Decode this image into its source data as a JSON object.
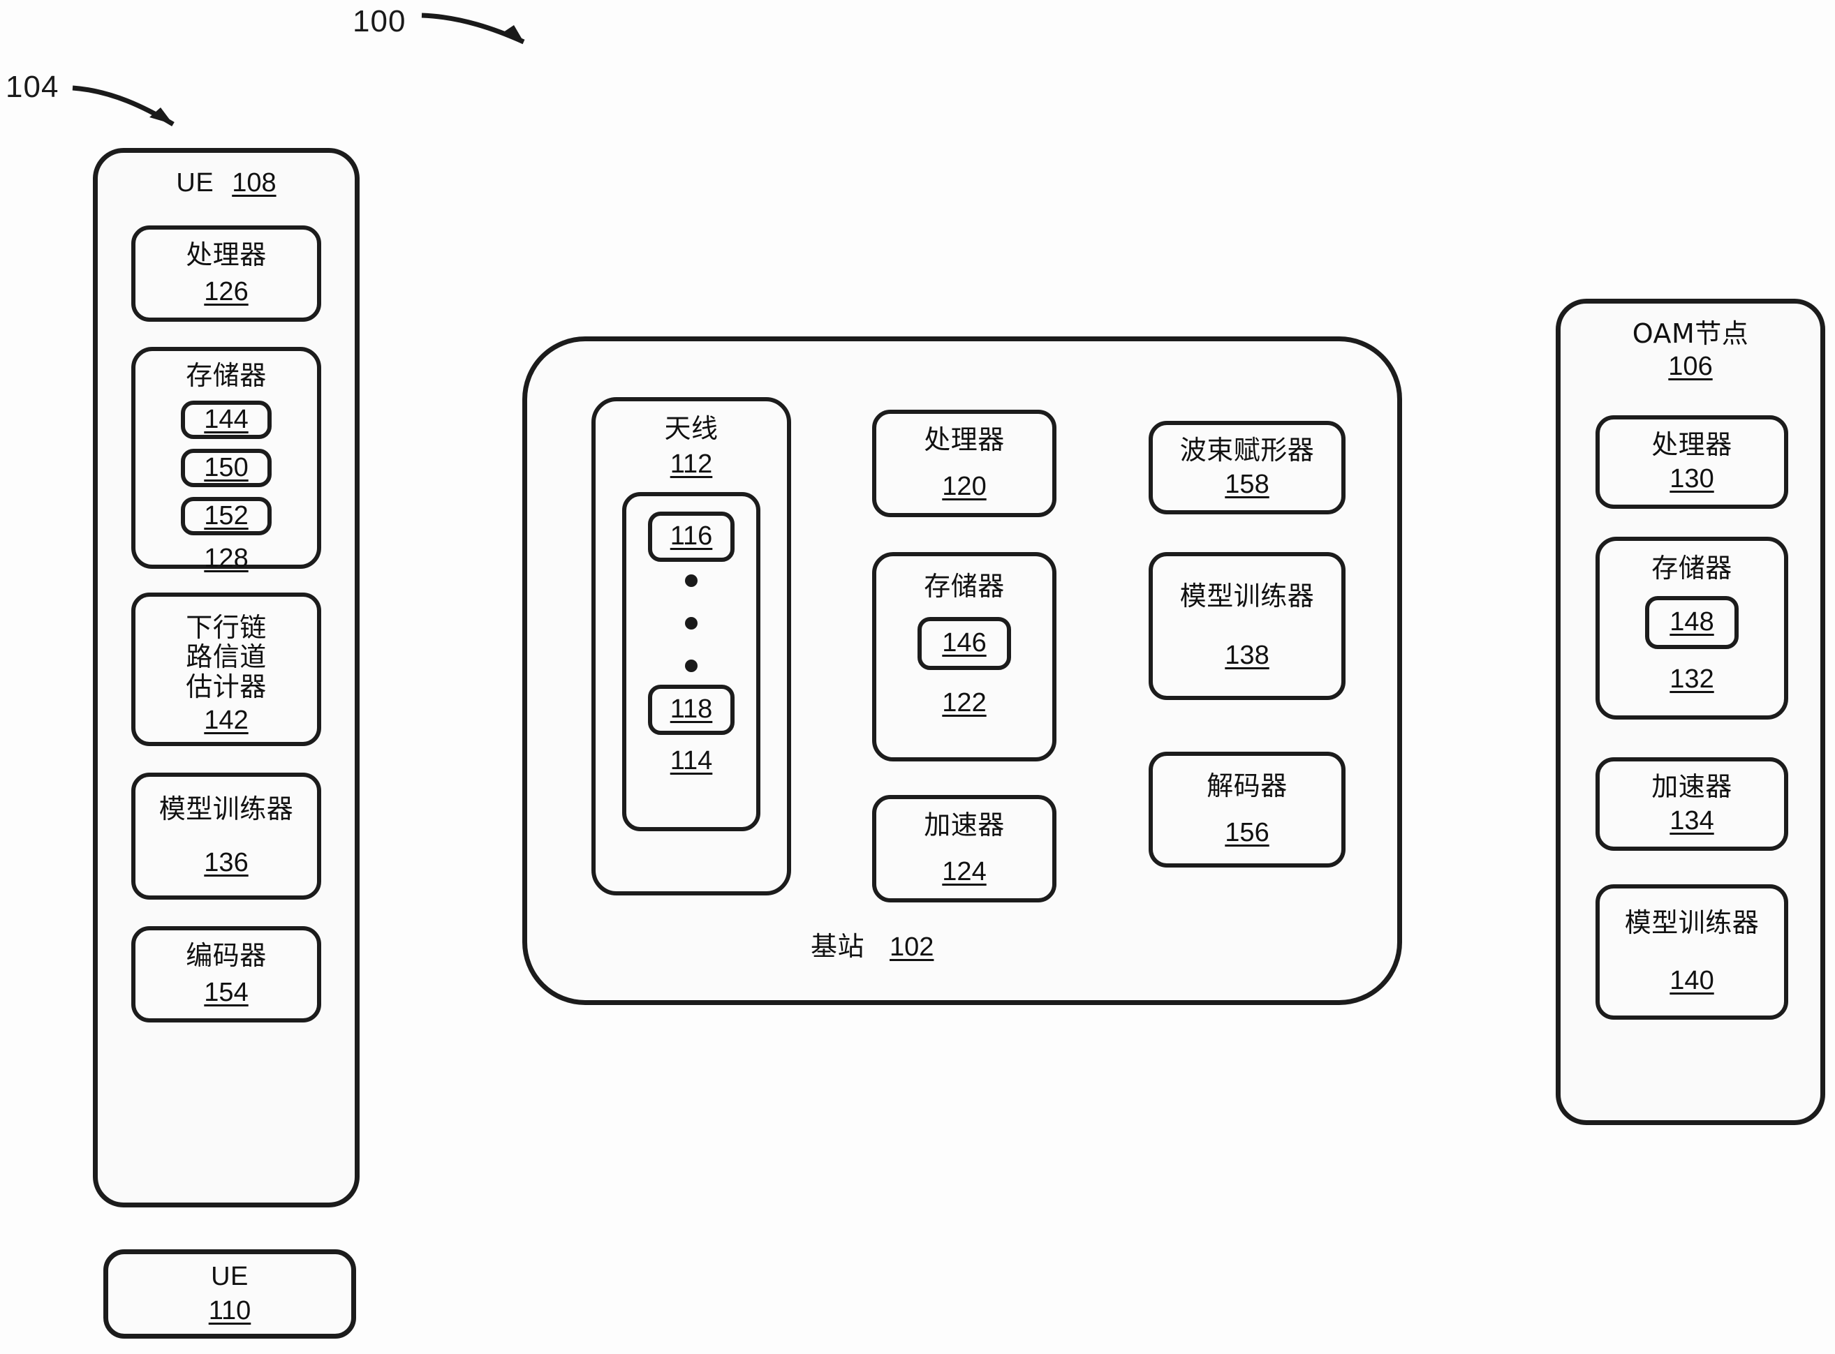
{
  "figure": {
    "system_callout": "100",
    "ue_group_callout": "104"
  },
  "ue_108": {
    "title": "UE",
    "ref": "108",
    "processor": {
      "label": "处理器",
      "ref": "126"
    },
    "memory": {
      "label": "存储器",
      "ref": "128",
      "items": [
        {
          "ref": "144"
        },
        {
          "ref": "150"
        },
        {
          "ref": "152"
        }
      ]
    },
    "dl_channel_estimator": {
      "label": "下行链\n路信道\n估计器",
      "ref": "142"
    },
    "model_trainer": {
      "label": "模型训练器",
      "ref": "136"
    },
    "encoder": {
      "label": "编码器",
      "ref": "154"
    }
  },
  "ue_110": {
    "title": "UE",
    "ref": "110"
  },
  "base_station": {
    "title": "基站",
    "ref": "102",
    "antenna": {
      "label": "天线",
      "ref": "112",
      "array": {
        "ref": "114",
        "first": {
          "ref": "116"
        },
        "last": {
          "ref": "118"
        },
        "ellipsis_dots": 3
      }
    },
    "processor": {
      "label": "处理器",
      "ref": "120"
    },
    "memory": {
      "label": "存储器",
      "ref": "122",
      "items": [
        {
          "ref": "146"
        }
      ]
    },
    "accelerator": {
      "label": "加速器",
      "ref": "124"
    },
    "beamformer": {
      "label": "波束赋形器",
      "ref": "158"
    },
    "model_trainer": {
      "label": "模型训练器",
      "ref": "138"
    },
    "decoder": {
      "label": "解码器",
      "ref": "156"
    }
  },
  "oam_node": {
    "title": "OAM节点",
    "ref": "106",
    "processor": {
      "label": "处理器",
      "ref": "130"
    },
    "memory": {
      "label": "存储器",
      "ref": "132",
      "items": [
        {
          "ref": "148"
        }
      ]
    },
    "accelerator": {
      "label": "加速器",
      "ref": "134"
    },
    "model_trainer": {
      "label": "模型训练器",
      "ref": "140"
    }
  },
  "colors": {
    "stroke": "#1c1c1c",
    "background": "#fdfdfd",
    "fill": "#fbfbfb"
  }
}
